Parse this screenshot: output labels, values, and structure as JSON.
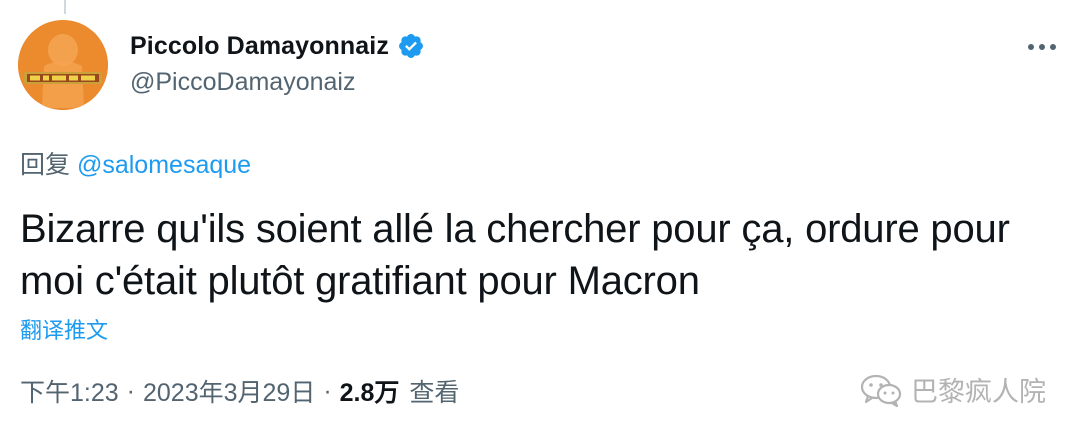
{
  "author": {
    "display_name": "Piccolo Damayonnaiz",
    "handle": "@PiccoDamayonaiz",
    "verified": true,
    "avatar_icon": "dragon-ball-avatar-icon"
  },
  "reply": {
    "prefix": "回复",
    "mention": "@salomesaque"
  },
  "tweet": {
    "text": "Bizarre qu'ils soient allé la chercher pour ça, ordure pour moi c'était plutôt gratifiant pour Macron"
  },
  "translate_label": "翻译推文",
  "meta": {
    "time": "下午1:23",
    "date": "2023年3月29日",
    "separator": "·",
    "views_count": "2.8万",
    "views_label": "查看"
  },
  "watermark": {
    "text": "巴黎疯人院",
    "icon": "wechat-icon"
  },
  "colors": {
    "accent": "#1d9bf0",
    "secondary_text": "#536471",
    "primary_text": "#0f1419",
    "avatar_bg": "#ea8a2d"
  }
}
